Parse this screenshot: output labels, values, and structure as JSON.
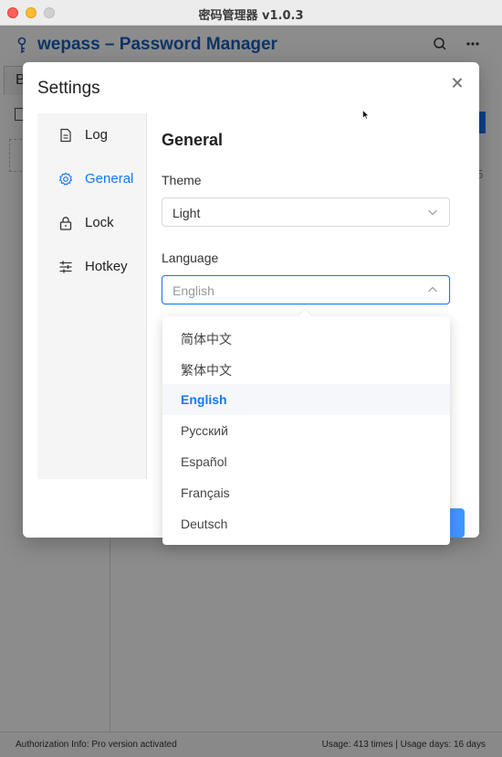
{
  "window": {
    "title": "密码管理器 v1.0.3"
  },
  "app": {
    "title": "wepass – Password Manager",
    "tab_label": "B",
    "side_number": "5",
    "footer": {
      "left": "Authorization Info: Pro version activated",
      "right": "Usage: 413 times | Usage days: 16 days"
    }
  },
  "settings": {
    "title": "Settings",
    "nav": [
      {
        "label": "Log",
        "icon": "document-icon"
      },
      {
        "label": "General",
        "icon": "gear-icon",
        "active": true
      },
      {
        "label": "Lock",
        "icon": "lock-icon"
      },
      {
        "label": "Hotkey",
        "icon": "sliders-icon"
      }
    ],
    "general": {
      "section_title": "General",
      "theme_label": "Theme",
      "theme_value": "Light",
      "language_label": "Language",
      "language_value": "English"
    }
  },
  "language_options": [
    "简体中文",
    "繁体中文",
    "English",
    "Русский",
    "Español",
    "Français",
    "Deutsch"
  ],
  "colors": {
    "accent": "#1677ff",
    "app_title": "#1b5fb8"
  }
}
